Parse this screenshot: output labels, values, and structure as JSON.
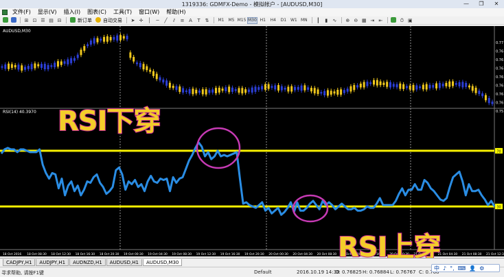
{
  "window": {
    "title": "1319336: GDMFX-Demo - 模拟帐户 - [AUDUSD,M30]",
    "min": "—",
    "max": "❐",
    "close": "✕"
  },
  "menu": [
    "文件(F)",
    "显示(V)",
    "插入(I)",
    "图表(C)",
    "工具(T)",
    "窗口(W)",
    "帮助(H)"
  ],
  "toolbar": {
    "new_order": "新订单",
    "auto_trading": "自动交易",
    "timeframes": [
      "M1",
      "M5",
      "M15",
      "M30",
      "H1",
      "H4",
      "D1",
      "W1",
      "MN"
    ],
    "active_timeframe": "M30"
  },
  "chart": {
    "symbol_label": "AUDUSD,M30",
    "rsi_label": "RSI(14) 40.3970",
    "price_ticks": [
      "0.77",
      "0.76",
      "0.76",
      "0.76",
      "0.76",
      "0.76",
      "0.76",
      "0.76",
      "0.75"
    ],
    "rsi_levels": [
      "70",
      "30"
    ],
    "x_labels": [
      "18 Oct 2016",
      "18 Oct 08:30",
      "18 Oct 12:30",
      "18 Oct 16:30",
      "18 Oct 20:30",
      "19 Oct 00:30",
      "19 Oct 04:30",
      "19 Oct 08:30",
      "19 Oct 12:30",
      "19 Oct 16:30",
      "19 Oct 20:30",
      "20 Oct 00:30",
      "20 Oct 04:30",
      "20 Oct 08:30",
      "20 Oct 12:30",
      "20 Oct 16:30",
      "20 Oct 20:30",
      "21 Oct 00:30",
      "21 Oct 04:30",
      "21 Oct 08:30",
      "21 Oct 12:30"
    ],
    "colors": {
      "bull": "#2c3fd6",
      "bear": "#f0c81e",
      "rsi": "#2a8de4",
      "level": "#f7f000",
      "circle": "#c63ab4"
    }
  },
  "annotations": {
    "rsi_down": "RSI下穿",
    "rsi_up": "RSI上穿"
  },
  "tabs": [
    "CADJPY,H1",
    "AUDJPY,H1",
    "AUDNZD,H1",
    "AUDUSD,H1",
    "AUDUSD,M30"
  ],
  "active_tab": "AUDUSD,M30",
  "status": {
    "help": "寻求帮助, 请按F1键",
    "profile": "Default",
    "datetime": "2016.10.19 14:30",
    "open": "O: 0.76825",
    "high": "H: 0.76884",
    "low": "L: 0.76767",
    "close": "C: 0.768"
  },
  "ime": {
    "items": [
      "中",
      "♪",
      "°,",
      "⌨",
      "👤",
      "⚙"
    ]
  },
  "chart_data": {
    "type": "line",
    "title": "RSI(14) 40.3970",
    "rsi_values": [
      68,
      71,
      72,
      71,
      71,
      69,
      71,
      71,
      70,
      69,
      69,
      69,
      71,
      60,
      54,
      50,
      54,
      53,
      43,
      50,
      38,
      45,
      48,
      41,
      45,
      38,
      42,
      48,
      47,
      51,
      53,
      47,
      44,
      39,
      41,
      44,
      56,
      58,
      53,
      42,
      48,
      46,
      49,
      44,
      46,
      41,
      48,
      52,
      48,
      47,
      50,
      49,
      50,
      41,
      51,
      47,
      50,
      51,
      57,
      63,
      67,
      72,
      76,
      73,
      66,
      69,
      64,
      66,
      70,
      66,
      67,
      66,
      67,
      68,
      69,
      50,
      32,
      33,
      31,
      30,
      29,
      31,
      33,
      27,
      29,
      25,
      27,
      29,
      24,
      26,
      29,
      33,
      26,
      33,
      27,
      27,
      29,
      32,
      34,
      31,
      28,
      34,
      31,
      33,
      31,
      28,
      30,
      32,
      30,
      28,
      28,
      29,
      27,
      27,
      28,
      30,
      29,
      29,
      32,
      36,
      31,
      31,
      31,
      31,
      34,
      39,
      43,
      38,
      42,
      42,
      46,
      42,
      42,
      49,
      47,
      43,
      41,
      38,
      35,
      34,
      36,
      44,
      51,
      53,
      55,
      48,
      38,
      46,
      41,
      41,
      42,
      38,
      35,
      31,
      34,
      30
    ],
    "levels": [
      70,
      30
    ],
    "ylim": [
      0,
      100
    ]
  }
}
